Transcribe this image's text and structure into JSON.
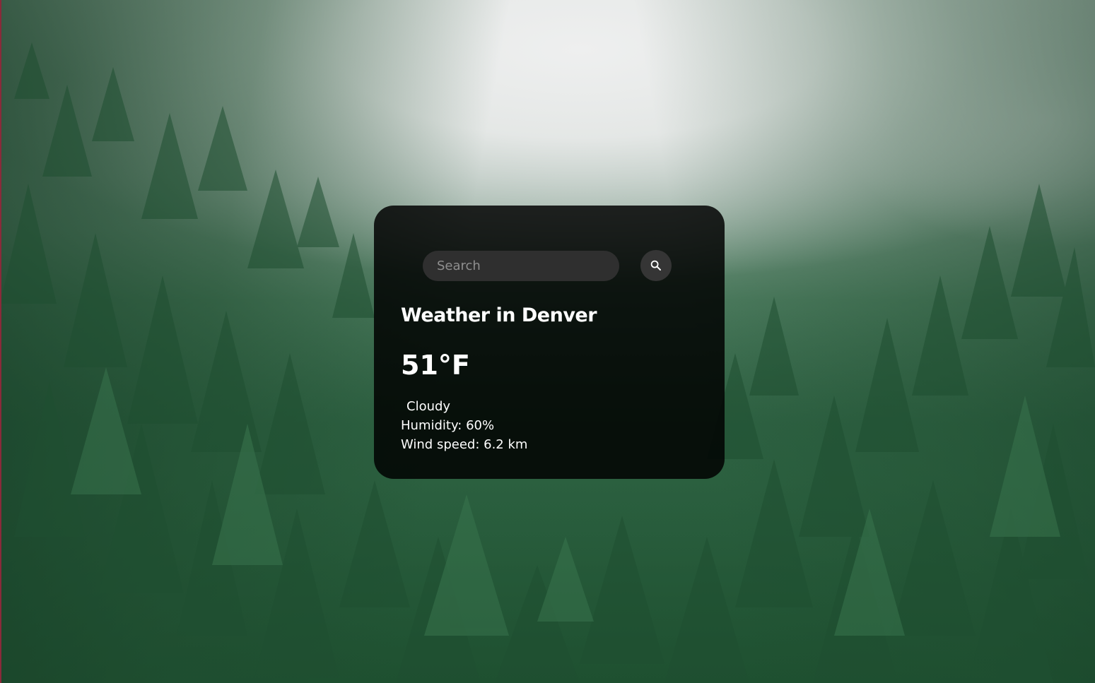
{
  "search": {
    "placeholder": "Search",
    "button_icon": "search-icon"
  },
  "weather": {
    "city_title": "Weather in Denver",
    "temperature": "51°F",
    "description": "Cloudy",
    "humidity": "Humidity: 60%",
    "wind": "Wind speed: 6.2 km"
  },
  "background": {
    "subject": "misty pine forest"
  },
  "colors": {
    "card_background": "#000000",
    "text": "#ffffff",
    "input_background": "#2f2f2f",
    "button_background": "#353535"
  }
}
